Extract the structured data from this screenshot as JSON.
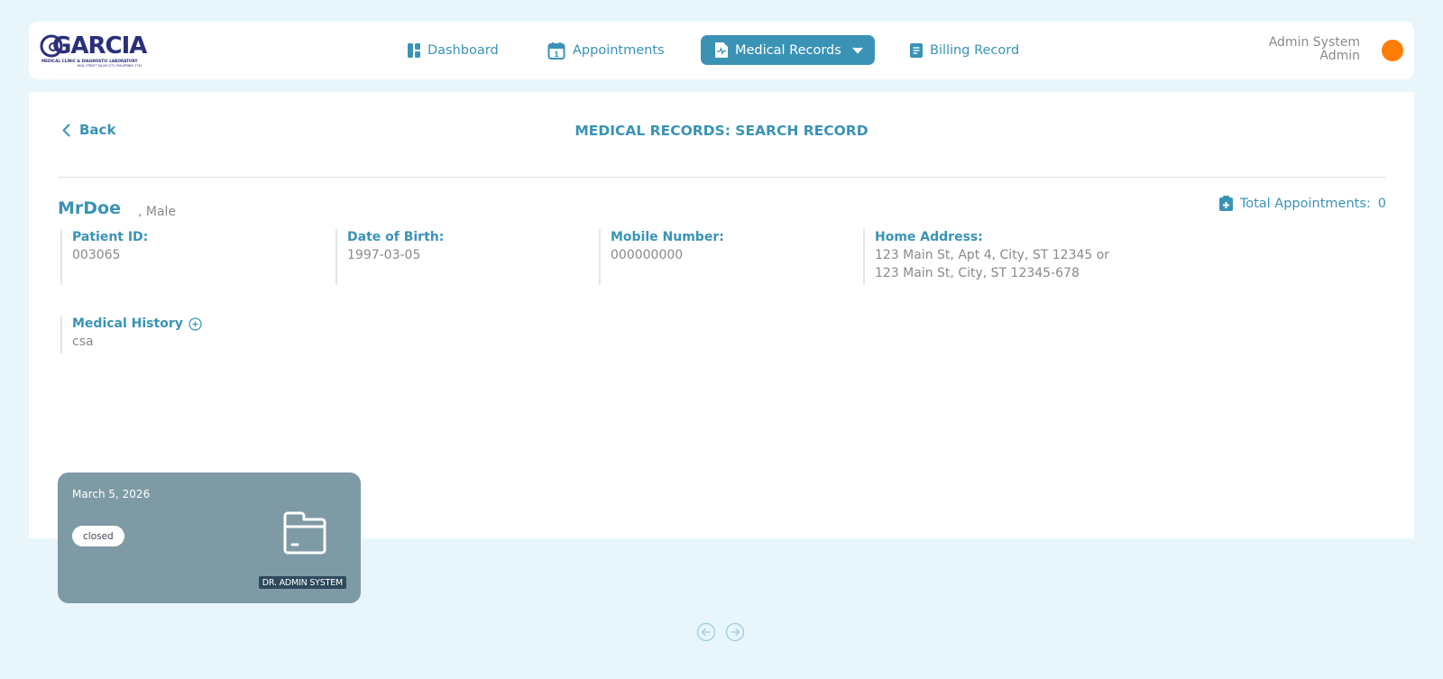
{
  "header": {
    "logo": {
      "name": "GARCIA",
      "subtitle": "MEDICAL CLINIC & DIAGNOSTIC LABORATORY",
      "address": "REAL STREET TALUM CITY, PHILIPPINES 3730"
    },
    "nav": [
      {
        "label": "Dashboard",
        "icon": "dashboard-icon"
      },
      {
        "label": "Appointments",
        "icon": "calendar-icon"
      },
      {
        "label": "Medical Records",
        "icon": "medical-file-icon",
        "active": true,
        "dropdown": true
      },
      {
        "label": "Billing Record",
        "icon": "document-icon"
      }
    ],
    "user": {
      "name": "Admin System",
      "role": "Admin",
      "avatar_color": "#ff7d04"
    }
  },
  "page": {
    "back_label": "Back",
    "title": "MEDICAL RECORDS: SEARCH RECORD"
  },
  "patient": {
    "name": "MrDoe",
    "sex": ", Male",
    "total_appointments_label": "Total Appointments:",
    "total_appointments": "0",
    "fields": [
      {
        "label": "Patient ID:",
        "value": "003065"
      },
      {
        "label": "Date of Birth:",
        "value": "1997-03-05"
      },
      {
        "label": "Mobile Number:",
        "value": "000000000"
      },
      {
        "label": "Home Address:",
        "value": "123 Main St, Apt 4, City, ST 12345 or 123 Main St, City, ST 12345-678"
      }
    ],
    "medical_history_label": "Medical History",
    "medical_history": "csa"
  },
  "records": [
    {
      "date": "March 5, 2026",
      "status": "closed",
      "doctor": "DR. ADMIN SYSTEM"
    }
  ],
  "colors": {
    "accent": "#3a93b5",
    "background": "#e8f6fc",
    "card": "#7e9aa5",
    "muted_text": "#8a8a8a"
  }
}
